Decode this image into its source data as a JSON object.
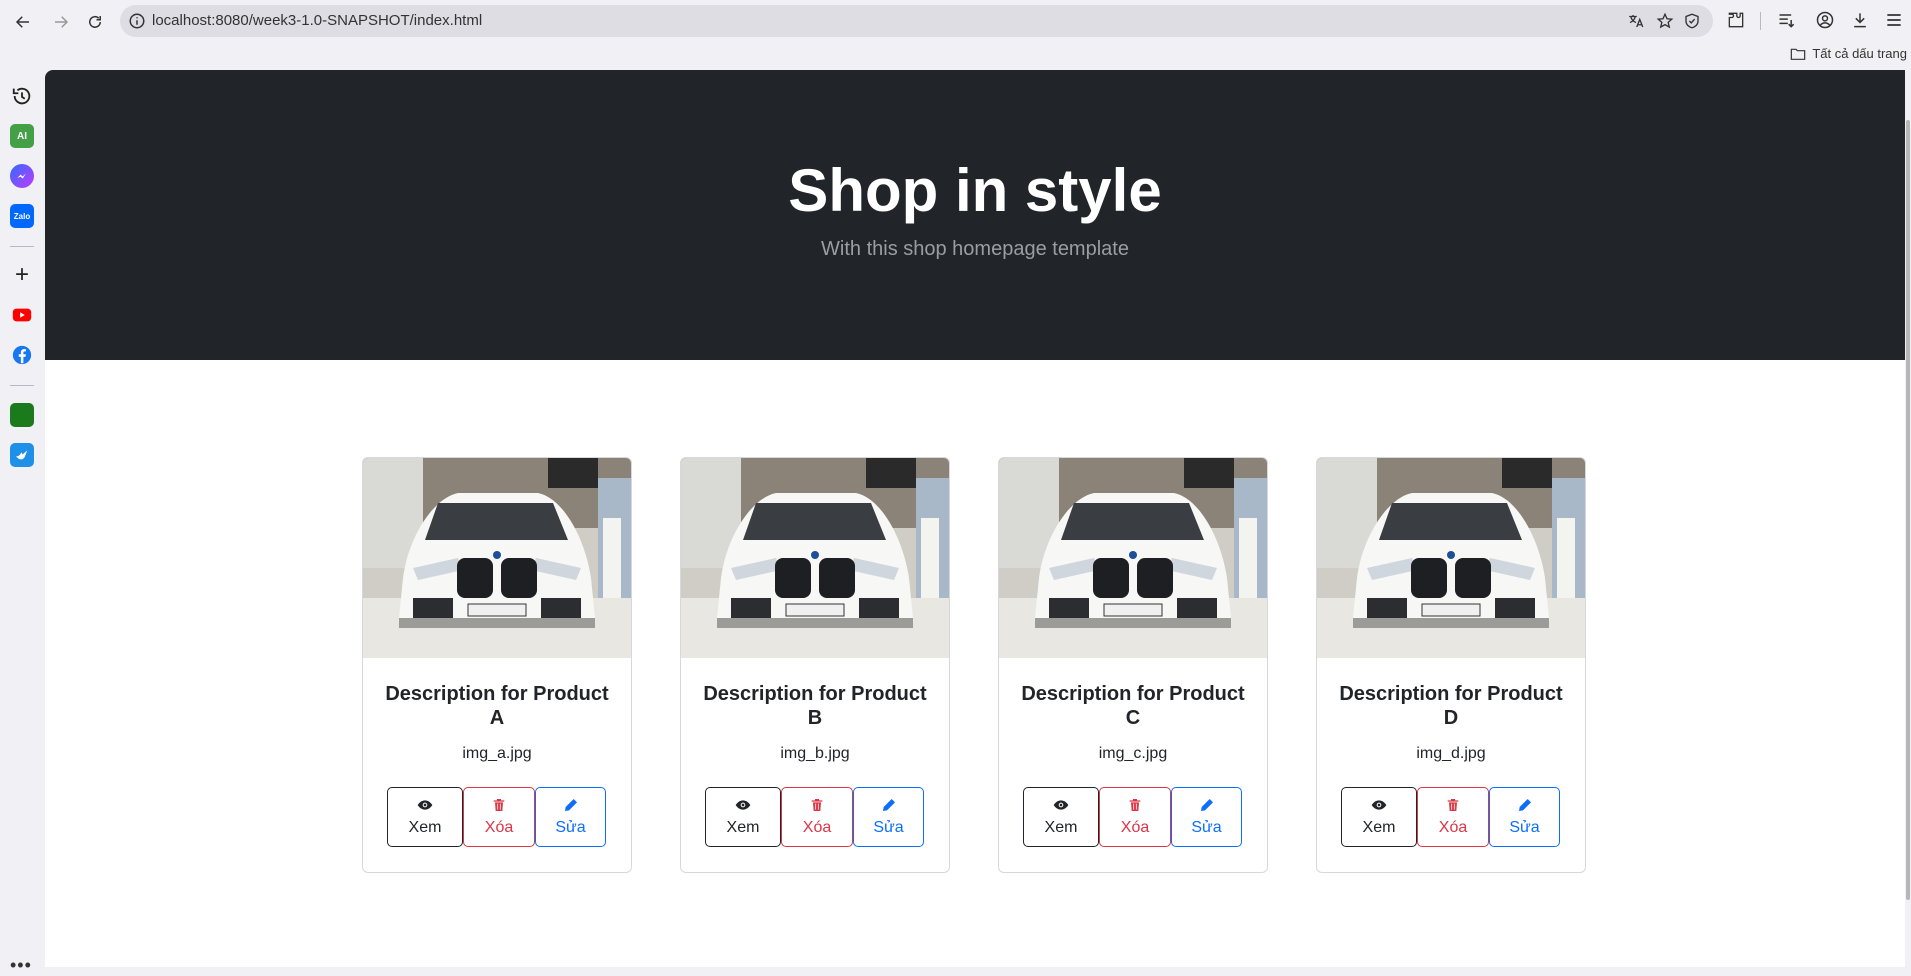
{
  "browser": {
    "url": "localhost:8080/week3-1.0-SNAPSHOT/index.html",
    "bookmarks_label": "Tất cả dấu trang",
    "sidebar_apps": [
      {
        "icon": "history-icon",
        "label": ""
      },
      {
        "icon": "ai-app-icon",
        "label": "AI"
      },
      {
        "icon": "messenger-icon",
        "label": ""
      },
      {
        "icon": "zalo-icon",
        "label": "Zalo"
      },
      {
        "icon": "add-icon",
        "label": ""
      },
      {
        "icon": "youtube-icon",
        "label": ""
      },
      {
        "icon": "facebook-icon",
        "label": ""
      },
      {
        "icon": "app-green-icon",
        "label": ""
      },
      {
        "icon": "app-blue-bird-icon",
        "label": ""
      }
    ]
  },
  "hero": {
    "title": "Shop in style",
    "subtitle": "With this shop homepage template"
  },
  "products": [
    {
      "title": "Description for Product A",
      "file": "img_a.jpg",
      "view": "Xem",
      "delete": "Xóa",
      "edit": "Sửa"
    },
    {
      "title": "Description for Product B",
      "file": "img_b.jpg",
      "view": "Xem",
      "delete": "Xóa",
      "edit": "Sửa"
    },
    {
      "title": "Description for Product C",
      "file": "img_c.jpg",
      "view": "Xem",
      "delete": "Xóa",
      "edit": "Sửa"
    },
    {
      "title": "Description for Product D",
      "file": "img_d.jpg",
      "view": "Xem",
      "delete": "Xóa",
      "edit": "Sửa"
    }
  ],
  "colors": {
    "hero_bg": "#212529",
    "view": "#212529",
    "delete": "#dc3545",
    "edit": "#0d6efd"
  }
}
